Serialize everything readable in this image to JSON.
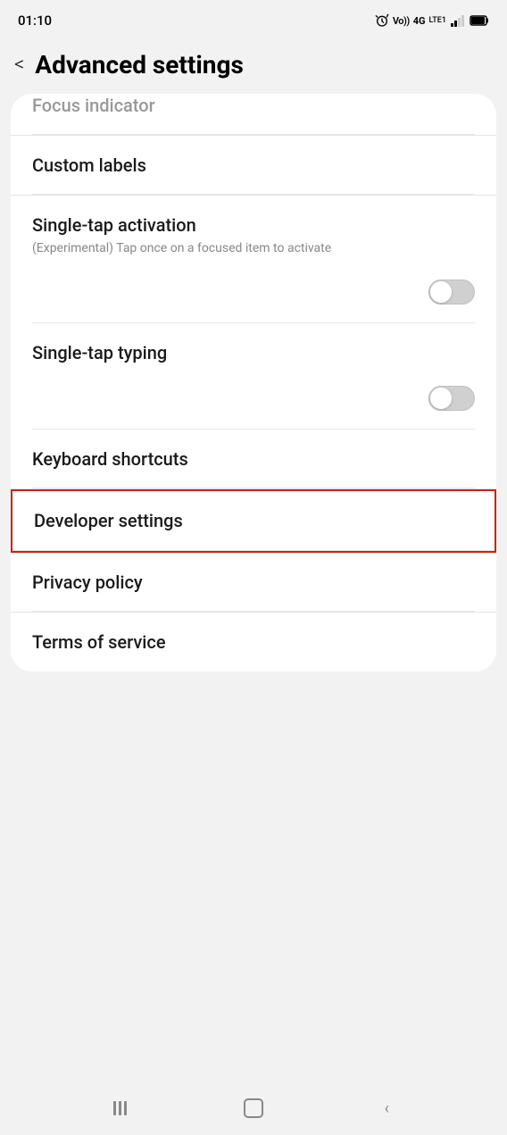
{
  "statusBar": {
    "time": "01:10",
    "icons": "🔔 Vo)) 4G LTE1 📶 🔋"
  },
  "header": {
    "backLabel": "<",
    "title": "Advanced settings"
  },
  "items": [
    {
      "id": "focus-indicator",
      "title": "Focus indicator",
      "subtitle": "",
      "hasToggle": false,
      "partiallyVisible": true,
      "highlighted": false
    },
    {
      "id": "custom-labels",
      "title": "Custom labels",
      "subtitle": "",
      "hasToggle": false,
      "partiallyVisible": false,
      "highlighted": false
    },
    {
      "id": "single-tap-activation",
      "title": "Single-tap activation",
      "subtitle": "(Experimental) Tap once on a focused item to activate",
      "hasToggle": true,
      "toggleState": false,
      "partiallyVisible": false,
      "highlighted": false
    },
    {
      "id": "single-tap-typing",
      "title": "Single-tap typing",
      "subtitle": "",
      "hasToggle": true,
      "toggleState": false,
      "partiallyVisible": false,
      "highlighted": false
    },
    {
      "id": "keyboard-shortcuts",
      "title": "Keyboard shortcuts",
      "subtitle": "",
      "hasToggle": false,
      "partiallyVisible": false,
      "highlighted": false
    },
    {
      "id": "developer-settings",
      "title": "Developer settings",
      "subtitle": "",
      "hasToggle": false,
      "partiallyVisible": false,
      "highlighted": true
    },
    {
      "id": "privacy-policy",
      "title": "Privacy policy",
      "subtitle": "",
      "hasToggle": false,
      "partiallyVisible": false,
      "highlighted": false
    },
    {
      "id": "terms-of-service",
      "title": "Terms of service",
      "subtitle": "",
      "hasToggle": false,
      "partiallyVisible": false,
      "highlighted": false
    }
  ],
  "bottomNav": {
    "recentLabel": "|||",
    "homeLabel": "○",
    "backLabel": "<"
  }
}
